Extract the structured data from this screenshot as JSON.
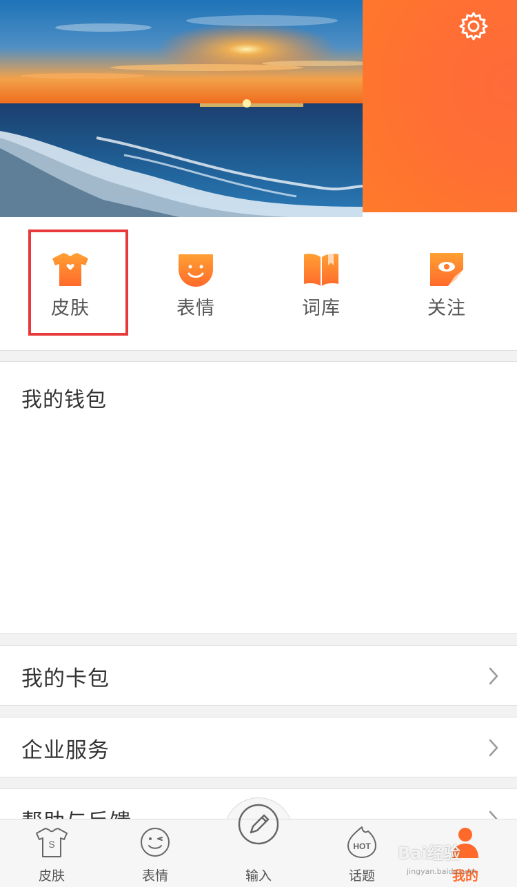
{
  "colors": {
    "accent": "#ff6a2b",
    "highlight_box": "#e8393a",
    "separator": "#f2f2f2"
  },
  "header": {
    "banner_image": "sunset-over-sea",
    "settings_icon": "gear-icon"
  },
  "quick_actions": [
    {
      "label": "皮肤",
      "icon": "tshirt-icon",
      "highlighted": true
    },
    {
      "label": "表情",
      "icon": "smiley-face-icon",
      "highlighted": false
    },
    {
      "label": "词库",
      "icon": "open-book-icon",
      "highlighted": false
    },
    {
      "label": "关注",
      "icon": "eye-flag-icon",
      "highlighted": false
    }
  ],
  "wallet": {
    "title": "我的钱包"
  },
  "menu": [
    {
      "label": "我的卡包"
    },
    {
      "label": "企业服务"
    },
    {
      "label": "帮助与反馈"
    }
  ],
  "tabbar": [
    {
      "label": "皮肤",
      "icon": "skin-s-shirt-icon",
      "active": false
    },
    {
      "label": "表情",
      "icon": "wink-face-icon",
      "active": false
    },
    {
      "label": "输入",
      "icon": "pencil-icon",
      "active": false
    },
    {
      "label": "话题",
      "icon": "hot-flame-icon",
      "active": false
    },
    {
      "label": "我的",
      "icon": "person-icon",
      "active": true
    }
  ],
  "watermark": {
    "text": "Bai经验",
    "sub": "jingyan.baidu.com"
  }
}
